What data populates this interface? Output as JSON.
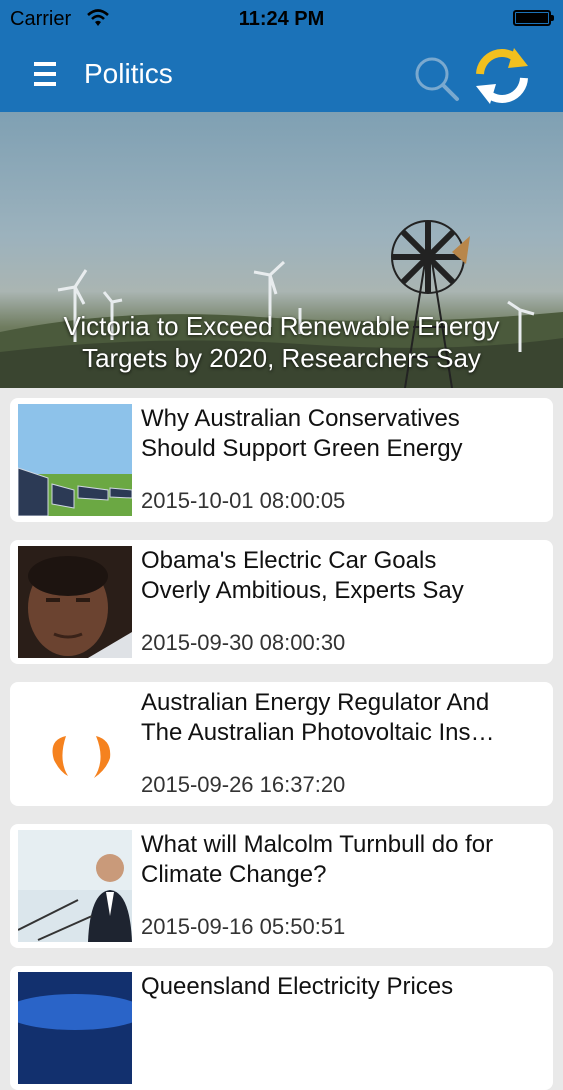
{
  "status_bar": {
    "carrier": "Carrier",
    "time": "11:24 PM"
  },
  "nav": {
    "title": "Politics"
  },
  "hero": {
    "title_line1": "Victoria to Exceed Renewable Energy",
    "title_line2": "Targets by 2020, Researchers Say"
  },
  "articles": [
    {
      "title_line1": "Why Australian Conservatives",
      "title_line2": "Should Support Green Energy",
      "date": "2015-10-01 08:00:05"
    },
    {
      "title_line1": "Obama's Electric Car Goals",
      "title_line2": "Overly Ambitious, Experts Say",
      "date": "2015-09-30 08:00:30"
    },
    {
      "title_line1": "Australian Energy Regulator And",
      "title_line2": "The Australian Photovoltaic Ins…",
      "date": "2015-09-26 16:37:20"
    },
    {
      "title_line1": "What will Malcolm Turnbull do for",
      "title_line2": "Climate Change?",
      "date": "2015-09-16 05:50:51"
    },
    {
      "title_line1": "Queensland Electricity Prices",
      "title_line2": "",
      "date": ""
    }
  ],
  "colors": {
    "nav_blue": "#1b72b8",
    "refresh_yellow": "#f2c01e",
    "logo_orange": "#f5821f"
  }
}
